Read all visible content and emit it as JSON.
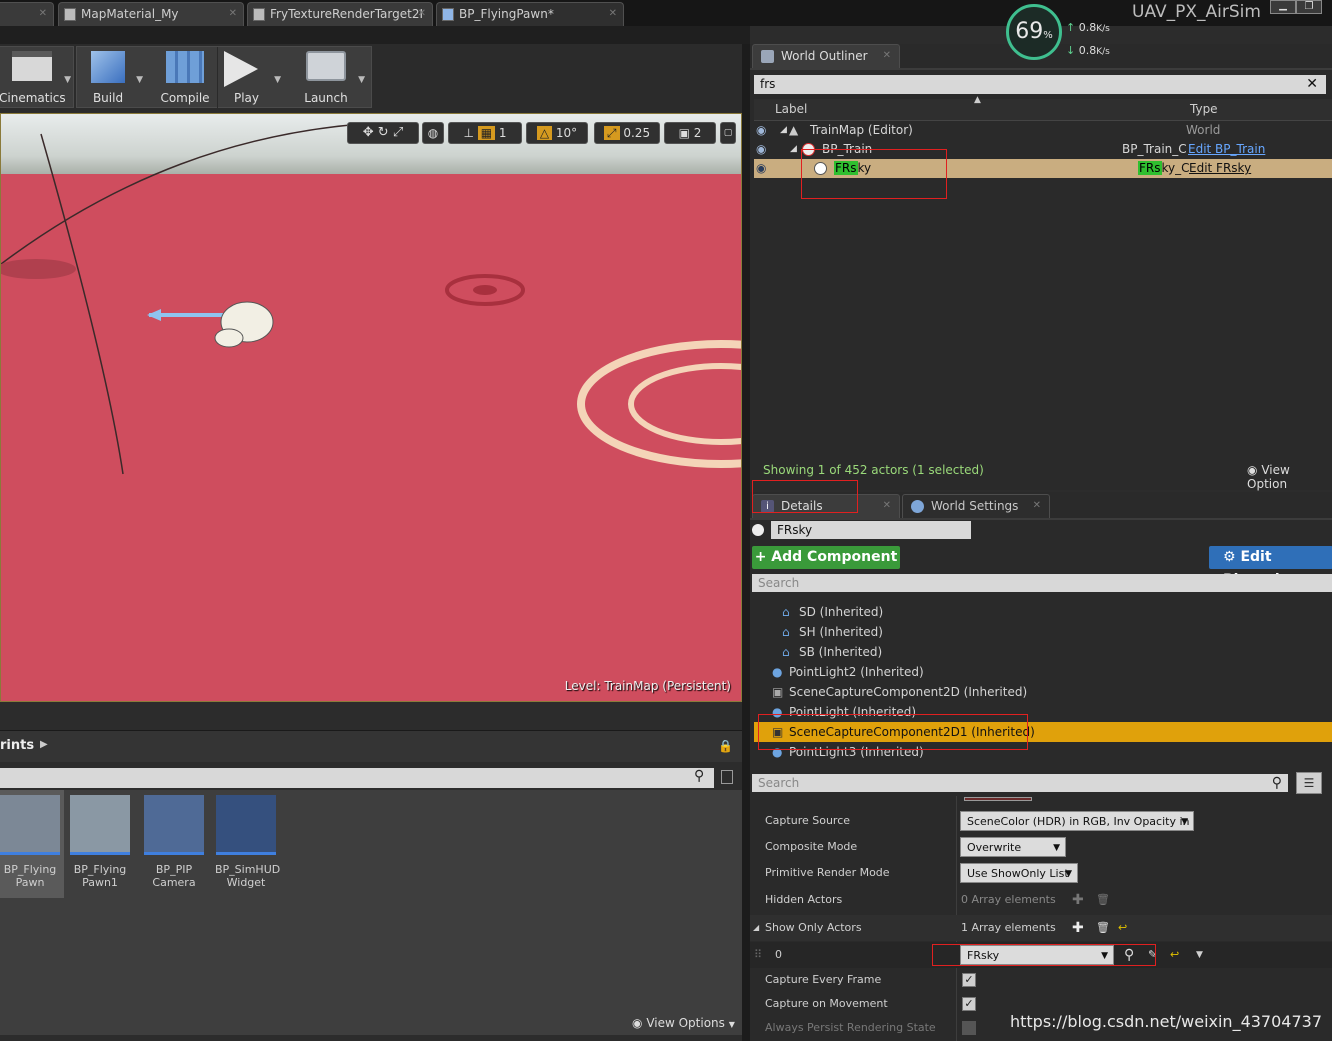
{
  "doc_tabs": [
    "MapMaterial_My",
    "FryTextureRenderTarget2I",
    "BP_FlyingPawn*"
  ],
  "project_name": "UAV_PX_AirSim",
  "perf": {
    "percent": "69",
    "pct_sign": "%",
    "up": "0.8",
    "down": "0.8",
    "unit": "K/s"
  },
  "toolbar": [
    {
      "label": "Cinematics",
      "icon": "cinematics-icon"
    },
    {
      "label": "Build",
      "icon": "build-icon"
    },
    {
      "label": "Compile",
      "icon": "compile-icon"
    },
    {
      "label": "Play",
      "icon": "play-icon"
    },
    {
      "label": "Launch",
      "icon": "launch-icon"
    }
  ],
  "viewport": {
    "grid_snap": "1",
    "rotation_snap": "10°",
    "scale_snap": "0.25",
    "camera_speed": "2",
    "level_label": "Level:  TrainMap (Persistent)"
  },
  "content_browser": {
    "title": "rints",
    "view_options": "View Options",
    "assets": [
      {
        "name": "BP_Flying\nPawn"
      },
      {
        "name": "BP_Flying\nPawn1"
      },
      {
        "name": "BP_PIP\nCamera"
      },
      {
        "name": "BP_SimHUD\nWidget"
      }
    ]
  },
  "outliner": {
    "tab": "World Outliner",
    "search_value": "frs",
    "col_label": "Label",
    "col_type": "Type",
    "rows": [
      {
        "label": "TrainMap (Editor)",
        "type": "World"
      },
      {
        "label": "BP_Train",
        "type_prefix": "BP_Train_C",
        "edit": "Edit BP_Train"
      },
      {
        "label_hl": "FRs",
        "label_rest": "ky",
        "type_hl": "FRs",
        "type_rest": "ky_C",
        "edit": "Edit FRsky"
      }
    ],
    "status": "Showing 1 of 452 actors (1 selected)",
    "view_options": "View Option"
  },
  "details": {
    "tab": "Details",
    "tab2": "World Settings",
    "name_value": "FRsky",
    "add_component": "+ Add Component ▾",
    "edit_blueprint": "Edit Blueprint",
    "search_placeholder": "Search",
    "components": [
      "SD (Inherited)",
      "SH (Inherited)",
      "SB (Inherited)",
      "PointLight2 (Inherited)",
      "SceneCaptureComponent2D (Inherited)",
      "PointLight (Inherited)",
      "SceneCaptureComponent2D1 (Inherited)",
      "PointLight3 (Inherited)"
    ],
    "props": [
      {
        "name": "Capture Source",
        "value": "SceneColor (HDR) in RGB, Inv Opacity in A"
      },
      {
        "name": "Composite Mode",
        "value": "Overwrite"
      },
      {
        "name": "Primitive Render Mode",
        "value": "Use ShowOnly List"
      },
      {
        "name": "Hidden Actors",
        "value": "0 Array elements"
      },
      {
        "name": "Show Only Actors",
        "value": "1 Array elements"
      },
      {
        "name": "0",
        "value": "FRsky"
      },
      {
        "name": "Capture Every Frame"
      },
      {
        "name": "Capture on Movement"
      },
      {
        "name": "Always Persist Rendering State"
      }
    ]
  },
  "watermark": "https://blog.csdn.net/weixin_43704737"
}
